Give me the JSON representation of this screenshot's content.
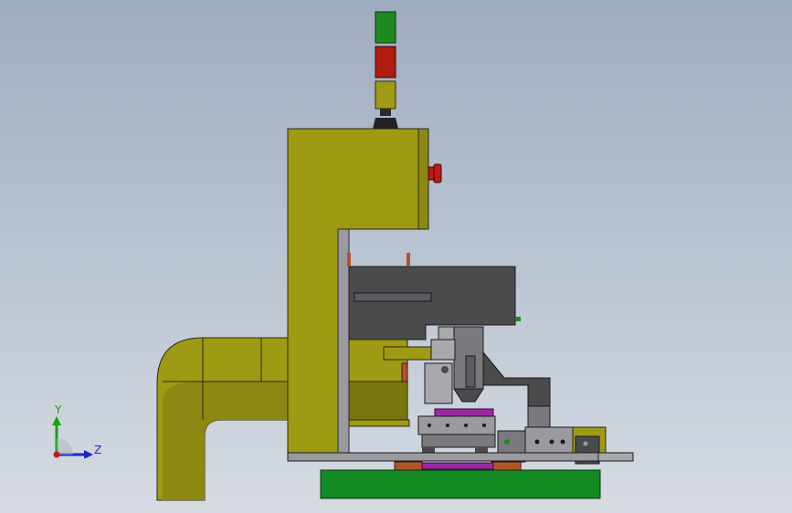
{
  "viewport": {
    "background_top": "#9eacbf",
    "background_bottom": "#d6dbe2"
  },
  "model": {
    "colors": {
      "frame_yellow": "#9e9a14",
      "frame_yellow_dark": "#6f6c0a",
      "outline": "#2a2a10",
      "steel_dark": "#4b4b4e",
      "steel_mid": "#7a7a7e",
      "steel_light": "#a9a9ad",
      "base_green": "#118a22",
      "magenta": "#9a2aa0",
      "copper": "#b0552a",
      "stack_green": "#1e8a1e",
      "stack_red": "#b01c10",
      "stack_amber": "#a09a16",
      "estop_red": "#c01818"
    },
    "stack_light_icon": "stack-light-icon",
    "estop_icon": "emergency-stop-icon"
  },
  "triad": {
    "y_label": "Y",
    "z_label": "Z",
    "y_color": "#15a015",
    "z_color": "#1a2ac0",
    "origin_color": "#c01818"
  }
}
